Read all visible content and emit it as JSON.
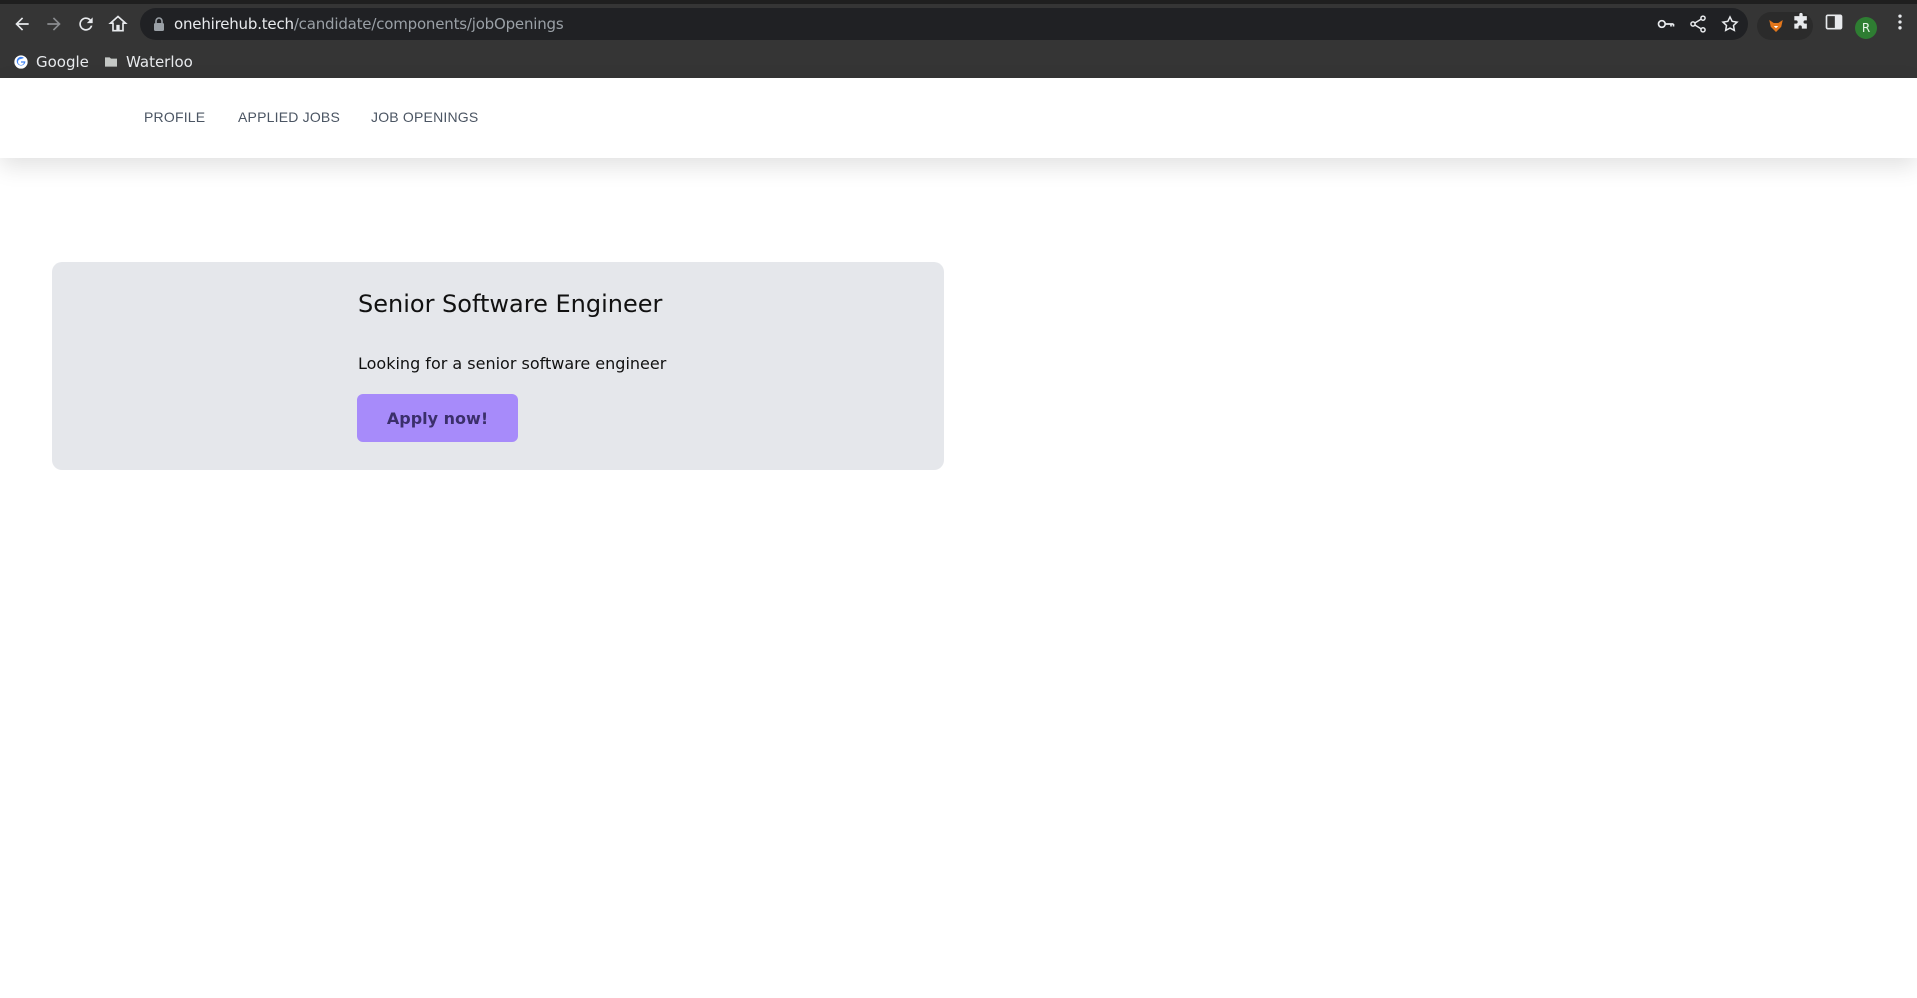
{
  "browser": {
    "url_host": "onehirehub.tech",
    "url_path": "/candidate/components/jobOpenings",
    "avatar_letter": "R",
    "bookmarks": [
      {
        "label": "Google",
        "icon": "google-icon"
      },
      {
        "label": "Waterloo",
        "icon": "folder-icon"
      }
    ]
  },
  "nav": {
    "items": [
      {
        "label": "PROFILE"
      },
      {
        "label": "APPLIED JOBS"
      },
      {
        "label": "JOB OPENINGS"
      }
    ]
  },
  "job": {
    "title": "Senior Software Engineer",
    "description": "Looking for a senior software engineer",
    "apply_label": "Apply now!"
  },
  "colors": {
    "card_bg": "#e5e7eb",
    "button_bg": "#a78bfa",
    "nav_text": "#4b5563"
  }
}
